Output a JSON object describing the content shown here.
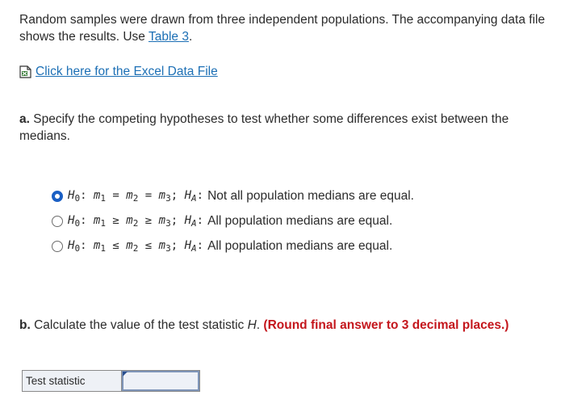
{
  "intro": {
    "text_before_link": "Random samples were drawn from three independent populations. The accompanying data file shows the results. Use ",
    "table_link": "Table 3",
    "text_after_link": "."
  },
  "excel_link": {
    "label": "Click here for the Excel Data File",
    "icon": "excel-file-icon"
  },
  "part_a": {
    "prefix": "a.",
    "question": " Specify the competing hypotheses to test whether some differences exist between the medians.",
    "options": [
      {
        "checked": true,
        "h0": "m1 = m2 = m3",
        "ha": "Not all population medians are equal."
      },
      {
        "checked": false,
        "h0": "m1 ≥ m2 ≥ m3",
        "ha": "All population medians are equal."
      },
      {
        "checked": false,
        "h0": "m1 ≤ m2 ≤ m3",
        "ha": "All population medians are equal."
      }
    ]
  },
  "part_b": {
    "prefix": "b.",
    "question_before": " Calculate the value of the test statistic ",
    "italic_var": "H",
    "question_after": ". ",
    "instruction": "(Round final answer to 3 decimal places.)"
  },
  "answer_table": {
    "label": "Test statistic",
    "value": ""
  },
  "colors": {
    "link": "#1c6fb5",
    "accent_red": "#c4161c",
    "radio_selected": "#1a5fc4"
  }
}
